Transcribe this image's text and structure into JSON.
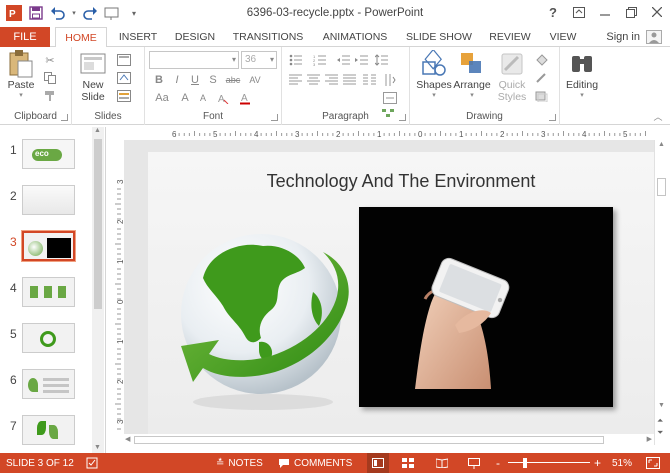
{
  "window": {
    "title": "6396-03-recycle.pptx - PowerPoint",
    "controls": [
      "help-icon",
      "ribbon-display-icon",
      "minimize-icon",
      "restore-icon",
      "close-icon"
    ],
    "help_label": "?"
  },
  "ribbon": {
    "file_label": "FILE",
    "tabs": [
      "HOME",
      "INSERT",
      "DESIGN",
      "TRANSITIONS",
      "ANIMATIONS",
      "SLIDE SHOW",
      "REVIEW",
      "VIEW"
    ],
    "active_tab": "HOME",
    "sign_in": "Sign in",
    "groups": {
      "clipboard": {
        "label": "Clipboard",
        "paste": "Paste"
      },
      "slides": {
        "label": "Slides",
        "new_slide_line1": "New",
        "new_slide_line2": "Slide"
      },
      "font": {
        "label": "Font",
        "font_size": "36",
        "buttons": [
          "B",
          "I",
          "U",
          "S",
          "abc",
          "AV",
          "Aa",
          "A",
          "A"
        ]
      },
      "paragraph": {
        "label": "Paragraph"
      },
      "drawing": {
        "label": "Drawing",
        "shapes": "Shapes",
        "arrange": "Arrange",
        "quick_styles_line1": "Quick",
        "quick_styles_line2": "Styles"
      },
      "editing": {
        "label": "Editing"
      }
    }
  },
  "ruler": {
    "h_ticks": [
      "6",
      "5",
      "4",
      "3",
      "2",
      "1",
      "0",
      "1",
      "2",
      "3",
      "4",
      "5",
      "6"
    ],
    "v_ticks": [
      "3",
      "2",
      "1",
      "0",
      "1",
      "2",
      "3"
    ]
  },
  "thumbnails": [
    {
      "num": "1",
      "selected": false,
      "caption": "eco"
    },
    {
      "num": "2",
      "selected": false,
      "caption": ""
    },
    {
      "num": "3",
      "selected": true,
      "caption": ""
    },
    {
      "num": "4",
      "selected": false,
      "caption": ""
    },
    {
      "num": "5",
      "selected": false,
      "caption": ""
    },
    {
      "num": "6",
      "selected": false,
      "caption": ""
    },
    {
      "num": "7",
      "selected": false,
      "caption": ""
    }
  ],
  "slide": {
    "title": "Technology And The Environment"
  },
  "statusbar": {
    "slide_info": "SLIDE 3 OF 12",
    "notes": "NOTES",
    "comments": "COMMENTS",
    "zoom": "51%",
    "zoom_minus": "-",
    "zoom_plus": "+",
    "zoom_level": 0.51
  },
  "colors": {
    "accent": "#d24726",
    "globe_green": "#3f9a1c"
  }
}
